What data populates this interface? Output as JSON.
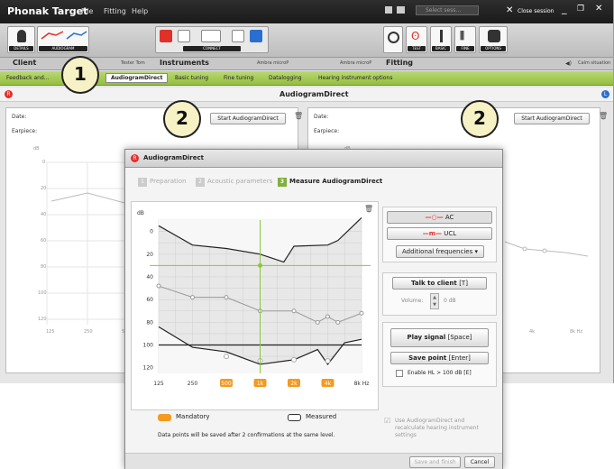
{
  "app": {
    "title": "Phonak Target",
    "menu": [
      "File",
      "Fitting",
      "Help"
    ],
    "close_session": "Close session",
    "search_placeholder": "Select sess...",
    "toolbar_labels": {
      "details": "DETAILS",
      "audiogram": "AUDIOGRAM",
      "connect": "CONNECT",
      "test": "TEST",
      "basic": "BASIC",
      "fine": "FINE",
      "options": "OPTIONS"
    }
  },
  "sections": {
    "client_label": "Client",
    "client_name": "Tester Tom",
    "instruments_label": "Instruments",
    "instrument_left": "Ambra microP",
    "instrument_right": "Ambra microP",
    "fitting_label": "Fitting",
    "calm_situation": "Calm situation"
  },
  "tabs": [
    "Feedback and...",
    "AudiogramDirect",
    "Basic tuning",
    "Fine tuning",
    "Datalogging",
    "Hearing instrument options"
  ],
  "main_header": "AudiogramDirect",
  "panels": {
    "date_label": "Date:",
    "earpiece_label": "Earpiece:",
    "start_button": "Start AudiogramDirect",
    "db_label": "dB",
    "left_yticks": [
      "0",
      "20",
      "40",
      "60",
      "80",
      "100",
      "120"
    ],
    "left_xticks": [
      "125",
      "250",
      "5"
    ],
    "right_xticks": [
      "4k",
      "8k Hz"
    ]
  },
  "callouts": {
    "one": "1",
    "two_left": "2",
    "two_right": "2"
  },
  "dialog": {
    "title": "AudiogramDirect",
    "steps": [
      {
        "num": "1",
        "label": "Preparation"
      },
      {
        "num": "2",
        "label": "Acoustic parameters"
      },
      {
        "num": "3",
        "label": "Measure AudiogramDirect"
      }
    ],
    "ac_label": "AC",
    "ucl_label": "UCL",
    "additional_frequencies": "Additional frequencies",
    "talk_to_client": "Talk to client",
    "talk_shortcut": "[T]",
    "volume_label": "Volume:",
    "volume_value": "0 dB",
    "play_signal": "Play signal",
    "play_shortcut": "[Space]",
    "save_point": "Save point",
    "save_shortcut": "[Enter]",
    "enable_hl": "Enable HL > 100 dB [E]",
    "use_checkbox": "Use AudiogramDirect and recalculate hearing instrument settings",
    "mandatory_label": "Mandatory",
    "measured_label": "Measured",
    "footnote": "Data points will be saved after 2 confirmations at the same level.",
    "save_finish": "Save and finish",
    "cancel": "Cancel",
    "colors": {
      "accent_green": "#7fb13a",
      "mandatory_orange": "#f39a1f",
      "ac_red": "#e0302a"
    }
  },
  "chart_data": {
    "type": "line",
    "ylabel": "dB",
    "x_categories": [
      "125",
      "250",
      "500",
      "1k",
      "2k",
      "4k",
      "8k Hz"
    ],
    "mandatory_x": [
      "500",
      "1k",
      "2k",
      "4k"
    ],
    "yticks": [
      "0",
      "20",
      "40",
      "60",
      "80",
      "100",
      "120"
    ],
    "ylim": [
      -10,
      125
    ],
    "cursor": {
      "x": "1k",
      "y": 30
    },
    "series": [
      {
        "name": "UCL",
        "x": [
          0,
          1,
          2,
          3,
          3.7,
          4,
          5,
          5.3,
          6
        ],
        "y": [
          -5,
          12,
          15,
          20,
          27,
          13,
          12,
          8,
          -12
        ]
      },
      {
        "name": "AC",
        "x": [
          0,
          1,
          2,
          3,
          4,
          4.7,
          5,
          5.3,
          6
        ],
        "y": [
          48,
          58,
          58,
          70,
          70,
          80,
          75,
          80,
          72
        ]
      },
      {
        "name": "AC",
        "x": [
          0,
          1,
          2,
          3,
          4,
          4.7,
          5,
          5.5,
          6
        ],
        "y": [
          84,
          102,
          106,
          117,
          113,
          104,
          117,
          98,
          95
        ]
      }
    ],
    "measured_points": {
      "x": [
        "500",
        "1k",
        "2k",
        "4k"
      ],
      "y": [
        110,
        114,
        113,
        114
      ]
    },
    "reference_line": 100,
    "grid": true
  }
}
